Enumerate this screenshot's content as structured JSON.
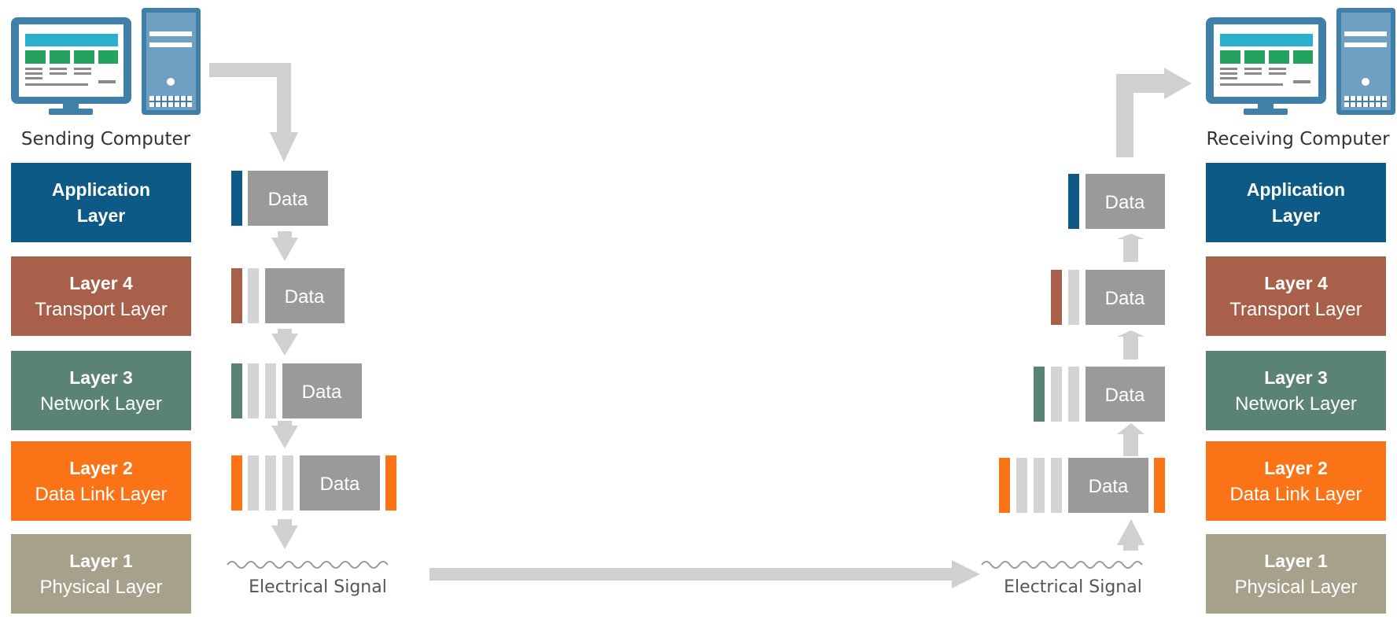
{
  "sender": {
    "label": "Sending Computer",
    "layers": [
      {
        "line1": "Application",
        "line2": "Layer",
        "color": "#0e5a87"
      },
      {
        "line1": "Layer 4",
        "line2": "Transport Layer",
        "color": "#a8604a"
      },
      {
        "line1": "Layer 3",
        "line2": "Network Layer",
        "color": "#5a8277"
      },
      {
        "line1": "Layer 2",
        "line2": "Data Link Layer",
        "color": "#fa7316"
      },
      {
        "line1": "Layer 1",
        "line2": "Physical Layer",
        "color": "#a7a08a"
      }
    ]
  },
  "receiver": {
    "label": "Receiving Computer",
    "layers": [
      {
        "line1": "Application",
        "line2": "Layer",
        "color": "#0e5a87"
      },
      {
        "line1": "Layer 4",
        "line2": "Transport Layer",
        "color": "#a8604a"
      },
      {
        "line1": "Layer 3",
        "line2": "Network Layer",
        "color": "#5a8277"
      },
      {
        "line1": "Layer 2",
        "line2": "Data Link Layer",
        "color": "#fa7316"
      },
      {
        "line1": "Layer 1",
        "line2": "Physical Layer",
        "color": "#a7a08a"
      }
    ]
  },
  "data_label": "Data",
  "signal_label": "Electrical Signal",
  "colors": {
    "arrow": "#d0d0d0",
    "data_block": "#9a9a9a",
    "header_stripe": "#d4d4d4",
    "monitor": "#3f7fa8",
    "screen_bar": "#2bb0d0",
    "screen_tiles": "#23a35e"
  },
  "icons": [
    "desktop-computer-icon",
    "desktop-computer-icon"
  ]
}
